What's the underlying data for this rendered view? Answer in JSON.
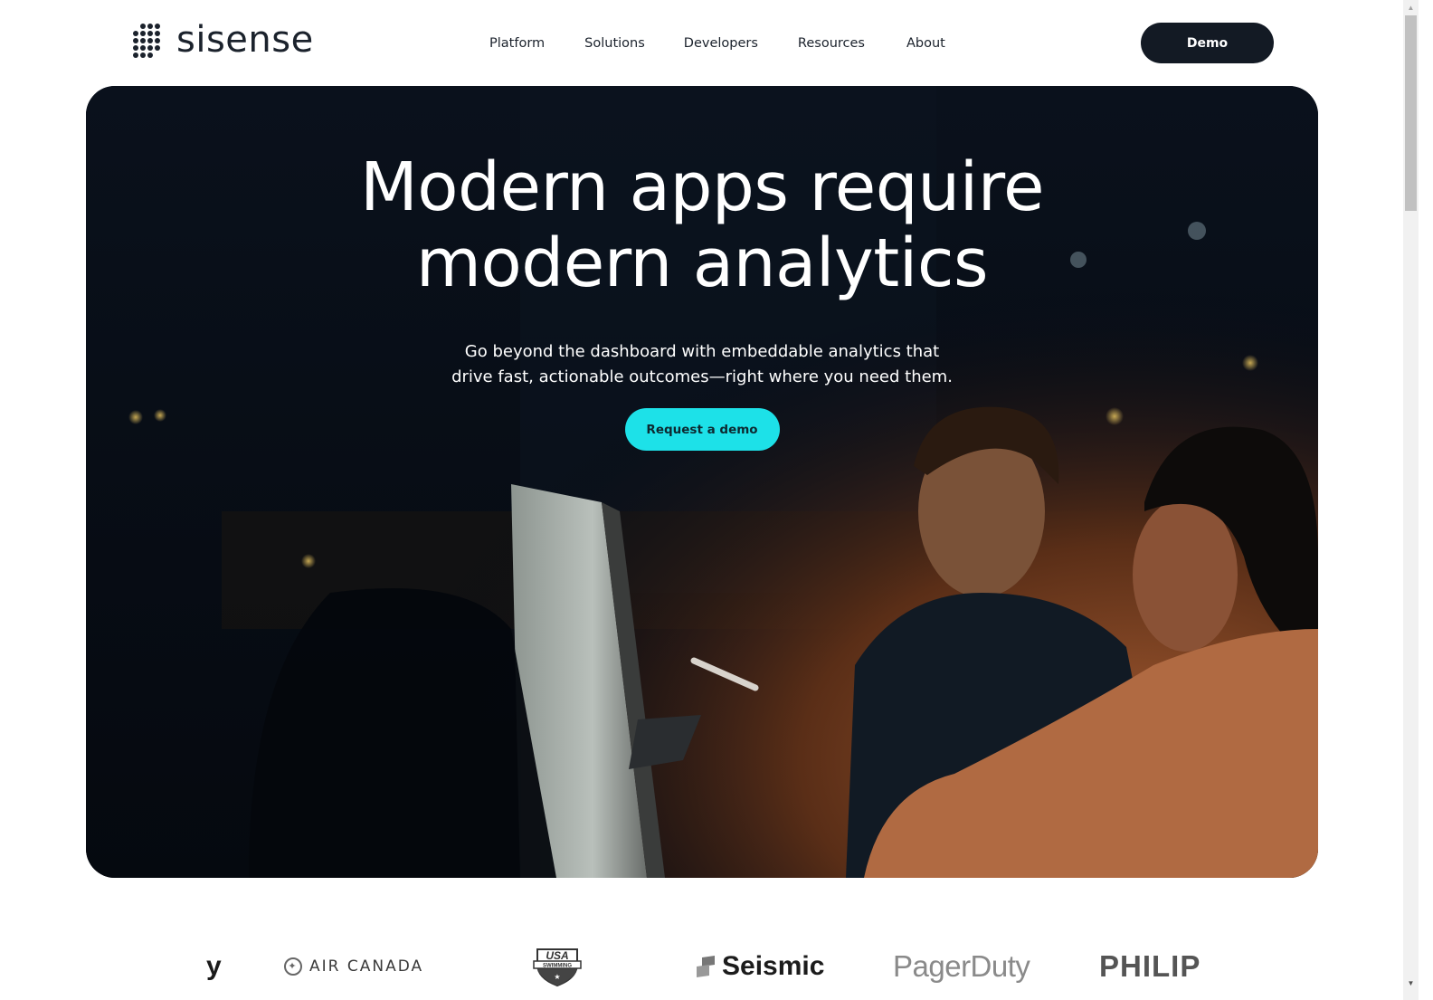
{
  "brand": {
    "name": "sisense"
  },
  "nav": {
    "items": [
      {
        "label": "Platform"
      },
      {
        "label": "Solutions"
      },
      {
        "label": "Developers"
      },
      {
        "label": "Resources"
      },
      {
        "label": "About"
      }
    ],
    "demo_button": "Demo"
  },
  "hero": {
    "title_line1": "Modern apps require",
    "title_line2": "modern analytics",
    "subtitle_line1": "Go beyond the dashboard with embeddable analytics that",
    "subtitle_line2": "drive fast, actionable outcomes—right where you need them.",
    "cta_label": "Request a demo",
    "image_description": "Two colleagues working at a computer monitor in a dark office at night",
    "cta_color": "#1de1e8"
  },
  "customer_logos": {
    "items": [
      {
        "name": "y",
        "partial": true
      },
      {
        "name": "AIR CANADA"
      },
      {
        "name": "USA Swimming",
        "text_top": "USA",
        "text_band": "SWIMMING"
      },
      {
        "name": "Seismic"
      },
      {
        "name": "PagerDuty"
      },
      {
        "name": "PHILIP",
        "partial": true
      }
    ]
  },
  "colors": {
    "primary_dark": "#131a24",
    "accent_cyan": "#1de1e8",
    "hero_bg": "#050a14"
  }
}
